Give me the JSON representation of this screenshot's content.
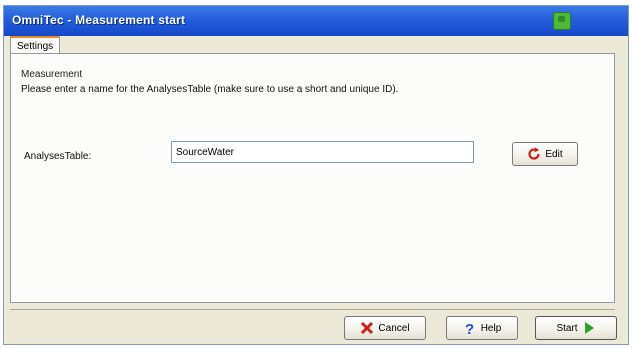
{
  "window": {
    "title": "OmniTec - Measurement start"
  },
  "tabs": [
    {
      "label": "Settings"
    }
  ],
  "measurement": {
    "group_label": "Measurement",
    "instruction": "Please enter a name for the AnalysesTable (make sure to use a short and unique ID).",
    "field_label": "AnalysesTable:",
    "field_value": "SourceWater",
    "edit_label": "Edit"
  },
  "footer": {
    "cancel_label": "Cancel",
    "help_label": "Help",
    "start_label": "Start"
  },
  "icons": {
    "title": "app-icon",
    "edit": "refresh-icon",
    "cancel": "x-icon",
    "help": "question-mark-icon",
    "start": "play-arrow-icon"
  },
  "colors": {
    "titlebar": "#245edc",
    "cancel_icon": "#d0201a",
    "edit_icon": "#d0201a",
    "help_icon": "#1f4fc8",
    "start_icon": "#2fa02a"
  }
}
